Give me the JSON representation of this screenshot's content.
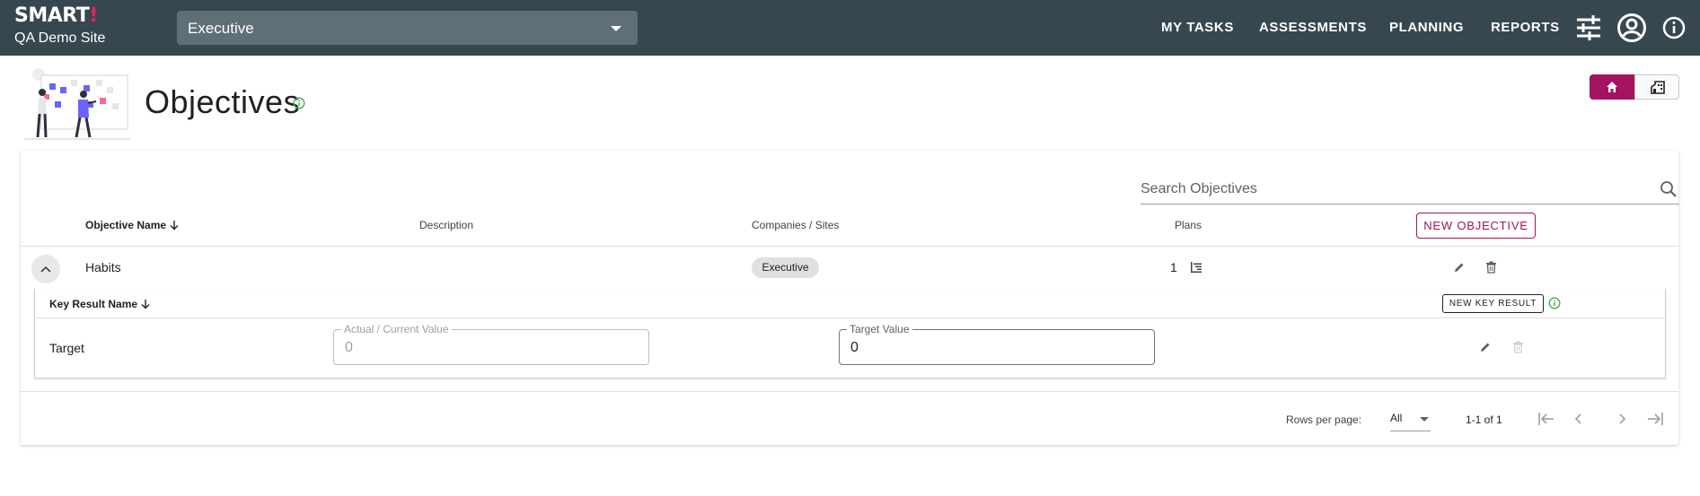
{
  "app": {
    "logo": "SMART",
    "logo_mark": "!",
    "site_name": "QA Demo Site"
  },
  "site_selector": {
    "value": "Executive"
  },
  "nav": {
    "my_tasks": "MY TASKS",
    "assessments": "ASSESSMENTS",
    "planning": "PLANNING",
    "reports": "REPORTS"
  },
  "header": {
    "title": "Objectives"
  },
  "search": {
    "placeholder": "Search Objectives"
  },
  "table": {
    "columns": {
      "name": "Objective Name",
      "description": "Description",
      "companies": "Companies / Sites",
      "plans": "Plans"
    },
    "new_button": "NEW OBJECTIVE",
    "rows": [
      {
        "name": "Habits",
        "description": "",
        "company": "Executive",
        "plans": "1"
      }
    ]
  },
  "key_results": {
    "column_name": "Key Result Name",
    "new_button": "NEW KEY RESULT",
    "rows": [
      {
        "name": "Target",
        "actual_label": "Actual / Current Value",
        "actual_value": "0",
        "target_label": "Target Value",
        "target_value": "0"
      }
    ]
  },
  "pagination": {
    "rows_per_page_label": "Rows per page:",
    "rows_per_page_value": "All",
    "range": "1-1 of 1"
  },
  "colors": {
    "topbar": "#37474f",
    "accent": "#a4135f",
    "success": "#4caf50"
  }
}
